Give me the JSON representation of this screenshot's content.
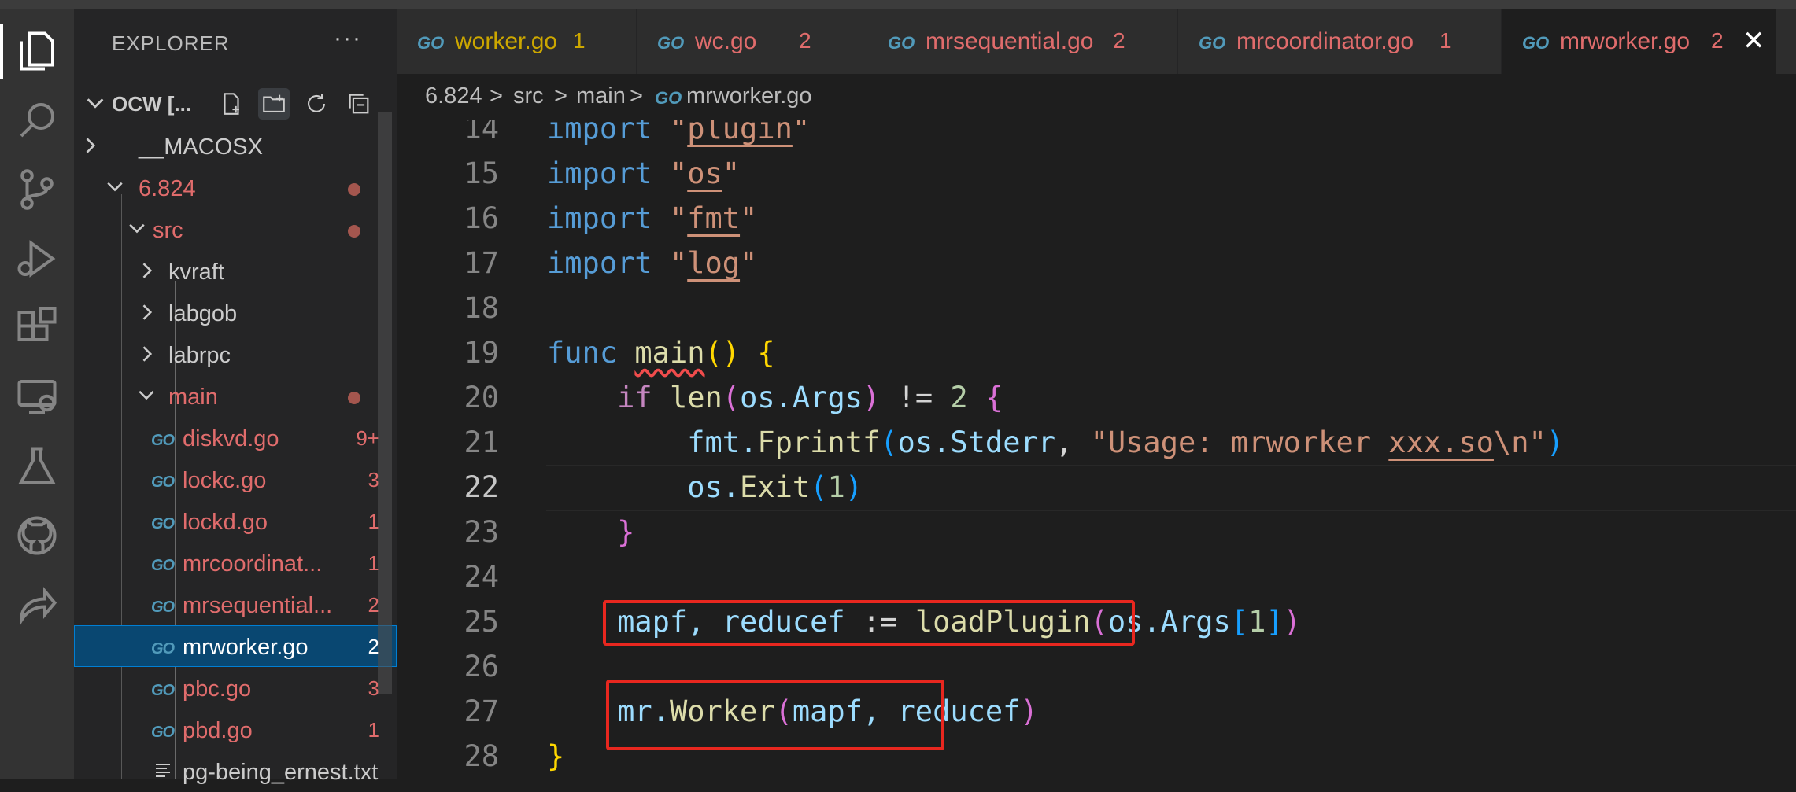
{
  "sidebar": {
    "title": "EXPLORER",
    "more": "···",
    "root_label": "OCW [...",
    "tree": [
      {
        "name": "__MACOSX"
      },
      {
        "name": "6.824"
      },
      {
        "name": "src"
      },
      {
        "name": "kvraft"
      },
      {
        "name": "labgob"
      },
      {
        "name": "labrpc"
      },
      {
        "name": "main"
      },
      {
        "name": "diskvd.go",
        "badge": "9+"
      },
      {
        "name": "lockc.go",
        "badge": "3"
      },
      {
        "name": "lockd.go",
        "badge": "1"
      },
      {
        "name": "mrcoordinat...",
        "badge": "1"
      },
      {
        "name": "mrsequential...",
        "badge": "2"
      },
      {
        "name": "mrworker.go",
        "badge": "2"
      },
      {
        "name": "pbc.go",
        "badge": "3"
      },
      {
        "name": "pbd.go",
        "badge": "1"
      },
      {
        "name": "pg-being_ernest.txt"
      }
    ],
    "go_icon": "GO"
  },
  "tabs": [
    {
      "name": "worker.go",
      "badge": "1"
    },
    {
      "name": "wc.go",
      "badge": "2"
    },
    {
      "name": "mrsequential.go",
      "badge": "2"
    },
    {
      "name": "mrcoordinator.go",
      "badge": "1"
    },
    {
      "name": "mrworker.go",
      "badge": "2",
      "close": "✕"
    }
  ],
  "breadcrumb": [
    "6.824",
    "src",
    "main",
    "mrworker.go"
  ],
  "breadcrumb_sep": ">",
  "code": {
    "line_numbers": [
      "14",
      "15",
      "16",
      "17",
      "18",
      "19",
      "20",
      "21",
      "22",
      "23",
      "24",
      "25",
      "26",
      "27",
      "28"
    ],
    "l14_kw": "import",
    "l14_q1": "\"",
    "l14_s": "plugin",
    "l14_q2": "\"",
    "l15_kw": "import",
    "l15_q1": "\"",
    "l15_s": "os",
    "l15_q2": "\"",
    "l16_kw": "import",
    "l16_q1": "\"",
    "l16_s": "fmt",
    "l16_q2": "\"",
    "l17_kw": "import",
    "l17_q1": "\"",
    "l17_s": "log",
    "l17_q2": "\"",
    "l19_kw": "func",
    "l19_fn": "main",
    "l19_p": "()",
    "l19_b": "{",
    "l20_kw": "if",
    "l20_fn": "len",
    "l20_po": "(",
    "l20_v": "os.Args",
    "l20_pc": ")",
    "l20_op": " != ",
    "l20_n": "2",
    "l20_b": "{",
    "l21_v": "fmt.",
    "l21_fn": "Fprintf",
    "l21_po": "(",
    "l21_v2": "os.Stderr",
    "l21_c": ", ",
    "l21_s1": "\"Usage: mrworker ",
    "l21_s2": "xxx.so",
    "l21_s3": "\\n\"",
    "l21_pc": ")",
    "l22_v": "os.",
    "l22_fn": "Exit",
    "l22_po": "(",
    "l22_n": "1",
    "l22_pc": ")",
    "l23_b": "}",
    "l25_v": "mapf, reducef",
    "l25_op": " := ",
    "l25_fn": "loadPlugin",
    "l25_po": "(",
    "l25_v2": "os.Args",
    "l25_bo": "[",
    "l25_n": "1",
    "l25_bc": "]",
    "l25_pc": ")",
    "l27_v": "mr.",
    "l27_fn": "Worker",
    "l27_po": "(",
    "l27_v2": "mapf, reducef",
    "l27_pc": ")",
    "l28_b": "}"
  },
  "colors": {
    "accent": "#007fd4",
    "error": "#e06c6c",
    "highlight_box": "#e8271f"
  }
}
